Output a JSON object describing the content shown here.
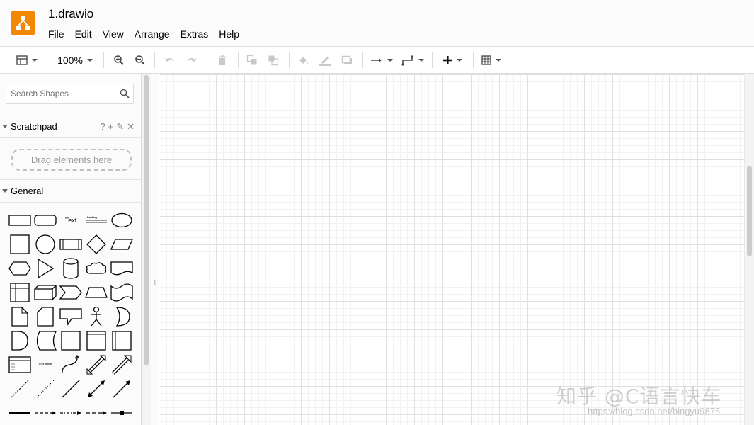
{
  "app": {
    "title": "1.drawio",
    "brand_color": "#f08705"
  },
  "menu": [
    "File",
    "Edit",
    "View",
    "Arrange",
    "Extras",
    "Help"
  ],
  "toolbar": {
    "zoom": "100%",
    "icons": [
      "format-panel-icon",
      "zoom-in-icon",
      "zoom-out-icon",
      "undo-icon",
      "redo-icon",
      "delete-icon",
      "to-front-icon",
      "to-back-icon",
      "fill-color-icon",
      "line-color-icon",
      "shadow-icon",
      "connection-arrow-icon",
      "waypoints-icon",
      "insert-plus-icon",
      "table-icon"
    ]
  },
  "sidebar": {
    "search_placeholder": "Search Shapes",
    "scratchpad": {
      "title": "Scratchpad",
      "tools": [
        "?",
        "+",
        "✎",
        "✕"
      ],
      "drop_hint": "Drag elements here"
    },
    "general": {
      "title": "General",
      "text_shape_label": "Text",
      "heading_shape_label": "Heading",
      "list_shape_label": "List Item"
    }
  },
  "collapse_handle": "||",
  "watermark": {
    "text": "知乎 @C语言快车",
    "url": "https://blog.csdn.net/bingyu9875"
  }
}
